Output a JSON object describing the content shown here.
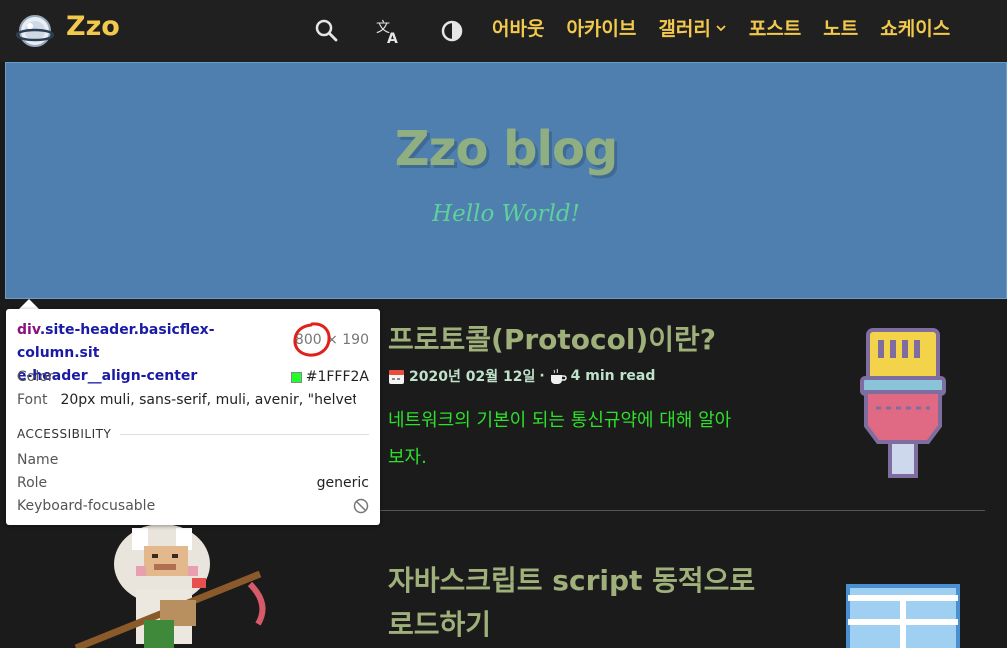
{
  "navbar": {
    "brand": "Zzo",
    "icons": [
      "search-icon",
      "translate-icon",
      "theme-toggle-icon"
    ],
    "links": [
      {
        "label": "어바웃"
      },
      {
        "label": "아카이브"
      },
      {
        "label": "갤러리",
        "dropdown": true
      },
      {
        "label": "포스트"
      },
      {
        "label": "노트"
      },
      {
        "label": "쇼케이스"
      }
    ]
  },
  "header": {
    "title": "Zzo blog",
    "subtitle": "Hello World!"
  },
  "posts": [
    {
      "title": "프로토콜(Protocol)이란?",
      "date": "2020년 02월 12일",
      "separator": "·",
      "read_time": "4 min read",
      "description_line1": "네트워크의 기본이 되는 통신규약에 대해 알아",
      "description_line2": "보자.",
      "thumbnail": "ethernet-cable-icon"
    },
    {
      "title_line1": "자바스크립트 script 동적으로",
      "title_line2": "로드하기",
      "thumbnail": "window-icon"
    }
  ],
  "devtools_tooltip": {
    "selector_tag": "div",
    "selector_classes_line1": ".site-header.basicflex-column.sit",
    "selector_classes_line2": "e-header__align-center",
    "width": "800",
    "height_text": " × 190",
    "color_label": "Color",
    "color_value": "#1FFF2A",
    "color_hex": "#1fff2a",
    "font_label": "Font",
    "font_value": "20px muli, sans-serif, muli, avenir, \"helvet...",
    "section_title": "ACCESSIBILITY",
    "name_label": "Name",
    "role_label": "Role",
    "role_value": "generic",
    "keyboard_label": "Keyboard-focusable"
  },
  "colors": {
    "accent": "#f2c94c",
    "header_bg": "#4f7fae",
    "page_bg": "#1b1b1b",
    "post_title": "#9fb07a",
    "post_desc": "#2ee02a"
  }
}
